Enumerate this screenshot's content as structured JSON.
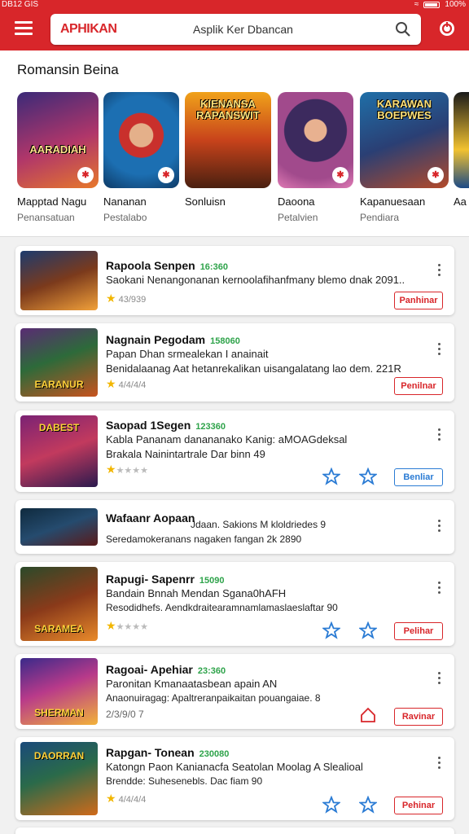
{
  "status": {
    "left": "DB12 GIS",
    "right": "100%"
  },
  "header": {
    "logo": "APHIKAN",
    "search_placeholder": "Asplik Ker Dbancan"
  },
  "recommended": {
    "title": "Romansin Beina",
    "items": [
      {
        "art": "AARADIAH",
        "name": "Mapptad Nagu",
        "sub": "Penansatuan"
      },
      {
        "art": "",
        "name": "Nananan",
        "sub": "Pestalabo"
      },
      {
        "art": "KIENANSA RAPANSWIT",
        "name": "Sonluisn",
        "sub": ""
      },
      {
        "art": "",
        "name": "Daoona",
        "sub": "Petalvien"
      },
      {
        "art": "KARAWAN BOEPWES",
        "name": "Kapanuesaan",
        "sub": "Pendiara"
      },
      {
        "art": "",
        "name": "Aa",
        "sub": ""
      }
    ]
  },
  "list": [
    {
      "thumb": "",
      "title": "Rapoola Senpen",
      "num": "16:360",
      "l1": "Saokani Nenangonanan kernoolafihanfmany blemo dnak 2091..",
      "l2": "",
      "rating": "43/939",
      "action": "Panhinar"
    },
    {
      "thumb": "EARANUR",
      "title": "Nagnain Pegodam",
      "num": "158060",
      "l1": "Papan Dhan srmealekan I anainait",
      "l2": "Benidalaanag Aat hetanrekalikan uisangalatang lao dem. 221R",
      "rating": "4/4/4/4",
      "action": "Penilnar"
    },
    {
      "thumb": "DABEST",
      "title": "Saopad 1Segen",
      "num": "123360",
      "l1": "Kabla Pananam danananako Kanig: aMOAGdeksal",
      "l2": "Brakala Nainintartrale Dar binn 49",
      "rating": "",
      "action": "Benliar"
    },
    {
      "thumb": "",
      "title": "Wafaanr Aopaan",
      "num": "",
      "l1": "Jdaan. Sakions M kloldriedes 9",
      "l2": "Seredamokeranans nagaken fangan 2k 2890",
      "rating": "",
      "action": ""
    },
    {
      "thumb": "SARAMEA",
      "title": "Rapugi- Sapenrr",
      "num": "15090",
      "l1": "Bandain Bnnah Mendan Sgana0hAFH",
      "l2": "Resodidhefs. Aendkdraitearamnamlamaslaeslaftar 90",
      "rating": "",
      "action": "Pelihar"
    },
    {
      "thumb": "SHERMAN",
      "title": "Ragoai- Apehiar",
      "num": "23:360",
      "l1": "Paronitan Kmanaatasbean apain AN",
      "l2": "Anaonuiragag: Apaltreranpaikaitan pouangaiae. 8",
      "rating": "2/3/9/0 7",
      "action": "Ravinar"
    },
    {
      "thumb": "DAORRAN",
      "title": "Rapgan- Tonean",
      "num": "230080",
      "l1": "Katongn Paon Kanianacfa Seatolan Moolag A Slealioal",
      "l2": "Brendde: Suhesenebls. Dac fiam 90",
      "rating": "4/4/4/4",
      "action": "Pehinar"
    }
  ],
  "colors": {
    "brand": "#d8262a",
    "accent_green": "#2ea34a",
    "link_blue": "#2a7bd4"
  }
}
